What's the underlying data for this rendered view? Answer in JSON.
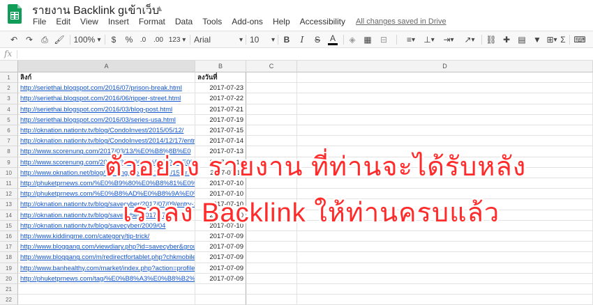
{
  "app": {
    "title": "รายงาน Backlink gเข้าเว็บ",
    "save_status": "All changes saved in Drive",
    "menu": [
      "File",
      "Edit",
      "View",
      "Insert",
      "Format",
      "Data",
      "Tools",
      "Add-ons",
      "Help",
      "Accessibility"
    ]
  },
  "toolbar": {
    "zoom": "100%",
    "currency": "$",
    "percent": "%",
    "dec_less": ".0",
    "dec_more": ".00",
    "number_format": "123",
    "font": "Arial",
    "font_size": "10",
    "bold": "B",
    "italic": "I",
    "strike": "S",
    "text_color": "A",
    "sigma": "Σ"
  },
  "formula_bar": {
    "fx": "fx",
    "value": ""
  },
  "columns": [
    "A",
    "B",
    "C",
    "D"
  ],
  "headers": {
    "a": "ลิงก์",
    "b": "ลงวันที่"
  },
  "rows": [
    {
      "n": "1",
      "a": "",
      "b": ""
    },
    {
      "n": "2",
      "a": "http://seriethai.blogspot.com/2016/07/prison-break.html",
      "b": "2017-07-23"
    },
    {
      "n": "3",
      "a": "http://seriethai.blogspot.com/2016/06/ripper-street.html",
      "b": "2017-07-22"
    },
    {
      "n": "4",
      "a": "http://seriethai.blogspot.com/2016/03/blog-post.html",
      "b": "2017-07-21"
    },
    {
      "n": "5",
      "a": "http://seriethai.blogspot.com/2016/03/series-usa.html",
      "b": "2017-07-19"
    },
    {
      "n": "6",
      "a": "http://oknation.nationtv.tv/blog/CondoInvest/2015/05/12/",
      "b": "2017-07-15"
    },
    {
      "n": "7",
      "a": "http://oknation.nationtv.tv/blog/CondoInvest/2014/12/17/entry",
      "b": "2017-07-14"
    },
    {
      "n": "8",
      "a": "http://www.scorenung.com/2017/03/13/%E0%B8%8B%E0",
      "b": "2017-07-13"
    },
    {
      "n": "9",
      "a": "http://www.scorenung.com/2017/03/13/%E0%B8%94%E0%B8",
      "b": "2017-07-12"
    },
    {
      "n": "10",
      "a": "http://www.oknation.net/blog/workingpaper/2017/07/15/entry-1",
      "b": "2017-07-11"
    },
    {
      "n": "11",
      "a": "http://phuketprnews.com/%E0%B9%80%E0%B8%81%E0%B8",
      "b": "2017-07-10"
    },
    {
      "n": "12",
      "a": "http://phuketprnews.com/%E0%B8%AD%E0%B8%9A%E0%B8",
      "b": "2017-07-10"
    },
    {
      "n": "13",
      "a": "http://oknation.nationtv.tv/blog/savecyber/2017/07/09/entry-1",
      "b": "2017-07-10"
    },
    {
      "n": "14",
      "a": "http://oknation.nationtv.tv/blog/savecyber/2017/07/03",
      "b": "2017-07-10"
    },
    {
      "n": "15",
      "a": "http://oknation.nationtv.tv/blog/savecyber/2009/04",
      "b": "2017-07-10"
    },
    {
      "n": "16",
      "a": "http://www.kiddingme.com/category/tip-trick/",
      "b": "2017-07-09"
    },
    {
      "n": "17",
      "a": "http://www.bloggang.com/viewdiary.php?id=savecyber&group",
      "b": "2017-07-09"
    },
    {
      "n": "18",
      "a": "http://www.bloggang.com/m/redirectfortablet.php?chkmobile=",
      "b": "2017-07-09"
    },
    {
      "n": "19",
      "a": "http://www.banhealthy.com/market/index.php?action=profile;",
      "b": "2017-07-09"
    },
    {
      "n": "20",
      "a": "http://phuketprnews.com/tag/%E0%B8%A3%E0%B8%B2%E0",
      "b": "2017-07-09"
    },
    {
      "n": "21",
      "a": "",
      "b": ""
    },
    {
      "n": "22",
      "a": "",
      "b": ""
    }
  ],
  "overlay": {
    "line1": "ตัวอย่าง รายงาน ที่ท่านจะได้รับหลัง",
    "line2": "เราลง Backlink ให้ท่านครบแล้ว",
    "color": "#ff2a2a"
  }
}
